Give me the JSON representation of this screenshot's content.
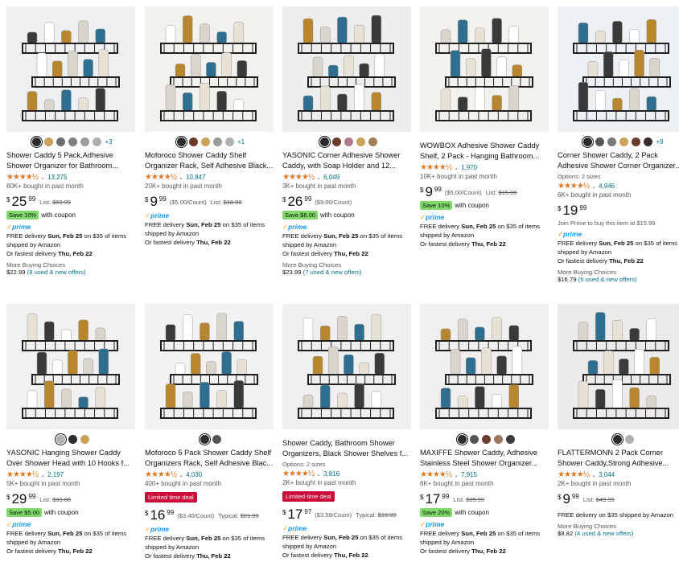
{
  "products": [
    {
      "title": "Shower Caddy 5 Pack,Adhesive Shower Organizer for Bathroom...",
      "swatches": [
        "#2b2b2b",
        "#c8a25a",
        "#6d6d6d",
        "#808080",
        "#9a9a9a",
        "#b0b0b0"
      ],
      "more_colors": "+3",
      "stars": "★★★★½",
      "reviews": "13,275",
      "bought": "80K+ bought in past month",
      "price_whole": "25",
      "price_frac": "99",
      "list_label": "List:",
      "list_price": "$69.99",
      "coupon_badge": "Save 10%",
      "coupon_text": "with coupon",
      "prime": "prime",
      "delivery": [
        "FREE delivery ",
        "Sun, Feb 25",
        " on $35 of items shipped by Amazon"
      ],
      "fastest": [
        "Or fastest delivery ",
        "Thu, Feb 22"
      ],
      "more_buying": "More Buying Choices",
      "mbc_price": "$22.99",
      "mbc_link": "(8 used & new offers)"
    },
    {
      "title": "Moforoco Shower Caddy Shelf Organizer Rack, Self Adhesive Black...",
      "swatches": [
        "#2b2b2b",
        "#6b3b2a",
        "#c8a25a",
        "#9a9a9a",
        "#b0b0b0"
      ],
      "more_colors": "+1",
      "stars": "★★★★½",
      "reviews": "10,847",
      "bought": "20K+ bought in past month",
      "price_whole": "9",
      "price_frac": "99",
      "unit": "($5.00/Count)",
      "list_label": "List:",
      "list_price": "$18.99",
      "prime": "prime",
      "delivery": [
        "FREE delivery ",
        "Sun, Feb 25",
        " on $35 of items shipped by Amazon"
      ],
      "fastest": [
        "Or fastest delivery ",
        "Thu, Feb 22"
      ]
    },
    {
      "title": "YASONIC Corner Adhesive Shower Caddy, with Soap Holder and 12...",
      "swatches": [
        "#2b2b2b",
        "#6b3b2a",
        "#b07a8c",
        "#c8a25a",
        "#a08050"
      ],
      "stars": "★★★★½",
      "reviews": "6,049",
      "bought": "3K+ bought in past month",
      "price_whole": "26",
      "price_frac": "99",
      "unit": "($9.00/Count)",
      "coupon_badge": "Save $6.00",
      "coupon_text": "with coupon",
      "prime": "prime",
      "delivery": [
        "FREE delivery ",
        "Sun, Feb 25",
        " on $35 of items shipped by Amazon"
      ],
      "fastest": [
        "Or fastest delivery ",
        "Thu, Feb 22"
      ],
      "more_buying": "More Buying Choices",
      "mbc_price": "$23.99",
      "mbc_link": "(7 used & new offers)"
    },
    {
      "title": "WOWBOX Adhesive Shower Caddy Shelf, 2 Pack - Hanging Bathroom...",
      "stars": "★★★★½",
      "reviews": "1,970",
      "bought": "10K+ bought in past month",
      "price_whole": "9",
      "price_frac": "99",
      "unit": "($5.00/Count)",
      "list_label": "List:",
      "list_price": "$15.99",
      "coupon_badge": "Save 10%",
      "coupon_text": "with coupon",
      "prime": "prime",
      "delivery": [
        "FREE delivery ",
        "Sun, Feb 25",
        " on $35 of items shipped by Amazon"
      ],
      "fastest": [
        "Or fastest delivery ",
        "Thu, Feb 22"
      ]
    },
    {
      "title": "Corner Shower Caddy, 2 Pack Adhesive Shower Corner Organizer...",
      "swatches": [
        "#2b2b2b",
        "#555555",
        "#777777",
        "#c8a25a",
        "#6b3b2a",
        "#3a2a2a"
      ],
      "more_colors": "+9",
      "options": "Options: 2 sizes",
      "stars": "★★★★½",
      "reviews": "4,946",
      "bought": "6K+ bought in past month",
      "price_whole": "19",
      "price_frac": "99",
      "prime_join": "Join Prime to buy this item at $15.99",
      "prime": "prime",
      "delivery": [
        "FREE delivery ",
        "Sun, Feb 25",
        " on $35 of items shipped by Amazon"
      ],
      "fastest": [
        "Or fastest delivery ",
        "Thu, Feb 22"
      ],
      "more_buying": "More Buying Choices",
      "mbc_price": "$16.79",
      "mbc_link": "(6 used & new offers)"
    },
    {
      "title": "YASONIC Hanging Shower Caddy Over Shower Head with 10 Hooks f...",
      "swatches": [
        "#b0b0b0",
        "#2b2b2b",
        "#c8a25a"
      ],
      "stars": "★★★★½",
      "reviews": "2,197",
      "bought": "5K+ bought in past month",
      "price_whole": "29",
      "price_frac": "99",
      "list_label": "List:",
      "list_price": "$33.88",
      "coupon_badge": "Save $5.00",
      "coupon_text": "with coupon",
      "prime": "prime",
      "delivery": [
        "FREE delivery ",
        "Sun, Feb 25",
        " on $35 of items shipped by Amazon"
      ],
      "fastest": [
        "Or fastest delivery ",
        "Thu, Feb 22"
      ]
    },
    {
      "title": "Moforoco 5 Pack Shower Caddy Shelf Organizers Rack, Self Adhesive Blac...",
      "swatches": [
        "#2b2b2b",
        "#555555"
      ],
      "stars": "★★★★½",
      "reviews": "4,030",
      "bought": "400+ bought in past month",
      "deal": "Limited time deal",
      "price_whole": "16",
      "price_frac": "99",
      "unit": "($3.40/Count)",
      "list_label": "Typical:",
      "list_price": "$21.99",
      "prime": "prime",
      "delivery": [
        "FREE delivery ",
        "Sun, Feb 25",
        " on $35 of items shipped by Amazon"
      ],
      "fastest": [
        "Or fastest delivery ",
        "Thu, Feb 22"
      ]
    },
    {
      "title": "Shower Caddy, Bathroom Shower Organizers, Black Shower Shelves f...",
      "options": "Options: 2 sizes",
      "stars": "★★★★½",
      "reviews": "3,816",
      "bought": "2K+ bought in past month",
      "deal": "Limited time deal",
      "price_whole": "17",
      "price_frac": "97",
      "unit": "($3.59/Count)",
      "list_label": "Typical:",
      "list_price": "$19.99",
      "prime": "prime",
      "delivery": [
        "FREE delivery ",
        "Sun, Feb 25",
        " on $35 of items shipped by Amazon"
      ],
      "fastest": [
        "Or fastest delivery ",
        "Thu, Feb 22"
      ]
    },
    {
      "title": "MAXIFFE Shower Caddy, Adhesive Stainless Steel Shower Organizer...",
      "swatches": [
        "#2b2b2b",
        "#555555",
        "#6b3b2a",
        "#a07860",
        "#3a3a3a"
      ],
      "stars": "★★★★½",
      "reviews": "7,915",
      "bought": "6K+ bought in past month",
      "price_whole": "17",
      "price_frac": "99",
      "list_label": "List:",
      "list_price": "$35.99",
      "coupon_badge": "Save 20%",
      "coupon_text": "with coupon",
      "prime": "prime",
      "delivery": [
        "FREE delivery ",
        "Sun, Feb 25",
        " on $35 of items shipped by Amazon"
      ],
      "fastest": [
        "Or fastest delivery ",
        "Thu, Feb 22"
      ]
    },
    {
      "title": "FLATTERMONN 2 Pack Corner Shower Caddy,Strong Adhesive...",
      "swatches": [
        "#2b2b2b",
        "#b0b0b0"
      ],
      "stars": "★★★★½",
      "reviews": "3,044",
      "bought": "2K+ bought in past month",
      "price_whole": "9",
      "price_frac": "99",
      "list_label": "List:",
      "list_price": "$49.99",
      "delivery_plain": "FREE delivery on $35 shipped by Amazon",
      "more_buying": "More Buying Choices",
      "mbc_price": "$8.82",
      "mbc_link": "(4 used & new offers)"
    }
  ]
}
